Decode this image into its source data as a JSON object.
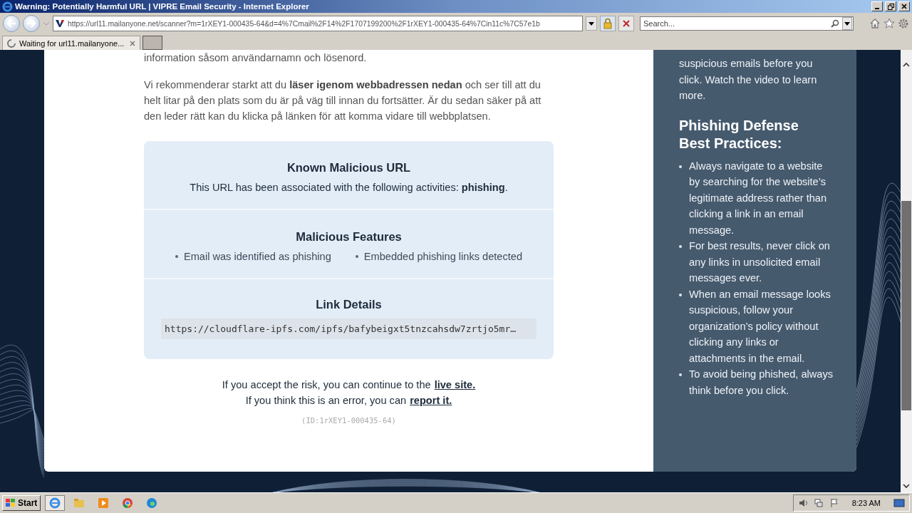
{
  "window": {
    "title": "Warning: Potentially Harmful URL | VIPRE Email Security - Internet Explorer"
  },
  "toolbar": {
    "address": "https://url11.mailanyone.net/scanner?m=1rXEY1-000435-64&d=4%7Cmail%2F14%2F1707199200%2F1rXEY1-000435-64%7Cin11c%7C57e1b",
    "search_placeholder": "Search..."
  },
  "tabs": [
    {
      "label": "Waiting for url11.mailanyone...",
      "selected": true,
      "loading": true
    }
  ],
  "page": {
    "paragraphs": [
      "information såsom användarnamn och lösenord.",
      "Vi rekommenderar starkt att du **läser igenom webbadressen nedan** och ser till att du helt litar på den plats som du är på väg till innan du fortsätter. Är du sedan säker på att den leder rätt kan du klicka på länken för att komma vidare till webbplatsen."
    ],
    "sections": [
      {
        "kind": "text",
        "title": "Known Malicious URL",
        "text": "This URL has been associated with the following activities: **phishing**."
      },
      {
        "kind": "bullets",
        "title": "Malicious Features",
        "items": [
          "Email was identified as phishing",
          "Embedded phishing links detected"
        ]
      },
      {
        "kind": "code",
        "title": "Link Details",
        "code": "https://cloudflare-ipfs.com/ipfs/bafybeigxt5tnzcahsdw7zrtjo5mr…"
      }
    ],
    "footer_lines": [
      {
        "text": "If you accept the risk, you can continue to the",
        "link": "live site."
      },
      {
        "text": "If you think this is an error, you can",
        "link": "report it."
      }
    ],
    "id_text": "(ID:1rXEY1-000435-64)"
  },
  "sidebar": {
    "intro": "suspicious emails before you click. Watch the video to learn more.",
    "heading": "Phishing Defense Best Practices:",
    "tips": [
      "Always navigate to a website by searching for the website’s legitimate address rather than clicking a link in an email message.",
      "For best results, never click on any links in unsolicited email messages ever.",
      "When an email message looks suspicious, follow your organization’s policy without clicking any links or attachments in the email.",
      "To avoid being phished, always think before you click."
    ]
  },
  "taskbar": {
    "start": "Start",
    "clock": "8:23 AM"
  }
}
